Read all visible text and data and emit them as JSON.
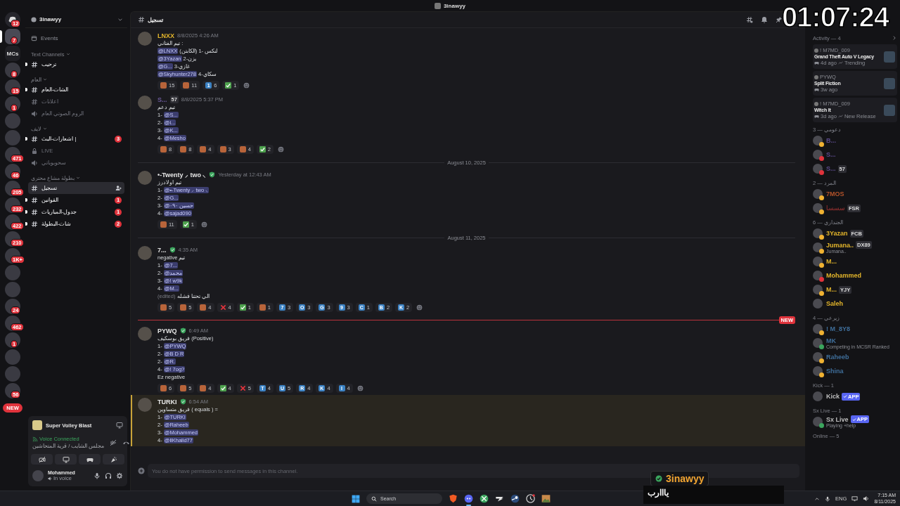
{
  "window": {
    "title": "3inawyy"
  },
  "server_rail": {
    "items": [
      {
        "kind": "home",
        "badge": "12",
        "selected": false
      },
      {
        "kind": "server",
        "badge": "7",
        "selected": true
      },
      {
        "kind": "text",
        "label": "MCs",
        "selected": false
      },
      {
        "kind": "server",
        "badge": "8",
        "selected": false
      },
      {
        "kind": "server",
        "badge": "15",
        "selected": false
      },
      {
        "kind": "server",
        "badge": "1",
        "selected": false
      },
      {
        "kind": "server",
        "selected": false
      },
      {
        "kind": "server",
        "selected": false
      },
      {
        "kind": "server",
        "badge": "471",
        "selected": false
      },
      {
        "kind": "server",
        "badge": "46",
        "selected": false
      },
      {
        "kind": "server",
        "badge": "205",
        "selected": false
      },
      {
        "kind": "server",
        "badge": "232",
        "selected": false
      },
      {
        "kind": "server",
        "badge": "422",
        "selected": false
      },
      {
        "kind": "server",
        "badge": "210",
        "selected": false
      },
      {
        "kind": "server",
        "badge": "1K+",
        "selected": false
      },
      {
        "kind": "server",
        "selected": false
      },
      {
        "kind": "server",
        "selected": false
      },
      {
        "kind": "server",
        "badge": "24",
        "selected": false
      },
      {
        "kind": "server",
        "badge": "462",
        "selected": false
      },
      {
        "kind": "server",
        "badge": "1",
        "selected": false
      },
      {
        "kind": "server",
        "selected": false
      },
      {
        "kind": "server",
        "selected": false
      },
      {
        "kind": "server",
        "badge": "56",
        "selected": false
      }
    ],
    "new_badge": "NEW"
  },
  "channel_sidebar": {
    "server_name": "3inawyy",
    "events": "Events",
    "categories": [
      {
        "name": "Text Channels",
        "channels": [
          {
            "name": "ترحيب",
            "kind": "text",
            "unread": true,
            "selected": false
          }
        ]
      },
      {
        "name": "العام",
        "channels": [
          {
            "name": "الشات-العام",
            "kind": "text",
            "unread": true,
            "selected": false
          },
          {
            "name": "اعلانات",
            "kind": "text",
            "unread": false,
            "selected": false
          },
          {
            "name": "الروم الصوتي العام",
            "kind": "voice",
            "unread": false,
            "selected": false
          }
        ]
      },
      {
        "name": "لايف",
        "channels": [
          {
            "name": "اشعارات-البث |",
            "kind": "text",
            "unread": true,
            "selected": false,
            "mentions": "3"
          },
          {
            "name": "LIVE",
            "kind": "locked",
            "unread": false,
            "selected": false
          },
          {
            "name": "سحوبوباتي",
            "kind": "voice",
            "unread": false,
            "selected": false
          }
        ]
      },
      {
        "name": "بطولة مشاع محتري",
        "channels": [
          {
            "name": "تسجيل",
            "kind": "text",
            "unread": false,
            "selected": true
          },
          {
            "name": "القوانين",
            "kind": "text",
            "unread": true,
            "selected": false,
            "mentions": "1"
          },
          {
            "name": "جدول-المباريات",
            "kind": "text",
            "unread": true,
            "selected": false,
            "mentions": "1"
          },
          {
            "name": "شات-البطولة",
            "kind": "text",
            "unread": true,
            "selected": false,
            "mentions": "2"
          }
        ]
      }
    ]
  },
  "voice_panel": {
    "activity": "Super Volley Blast",
    "status": "Voice Connected",
    "channel": "مجلس الشايب / قرية المتحاشين"
  },
  "user_panel": {
    "name": "Mohammed",
    "status": "In voice"
  },
  "chat": {
    "channel": "تسجيل",
    "input_placeholder": "You do not have permission to send messages in this channel.",
    "items": [
      {
        "kind": "message",
        "author": "LNXX",
        "color": "#e3b52b",
        "verified": false,
        "time": "8/8/2025 4:26 AM",
        "highlighted": false,
        "lines": [
          [
            {
              "kind": "text",
              "text": "تيم الفتاني :"
            }
          ],
          [
            {
              "kind": "mention",
              "text": "@LNXX"
            },
            {
              "kind": "text",
              "text": " (الكابتن) لنكس -1"
            }
          ],
          [
            {
              "kind": "mention",
              "text": "@3Yazan"
            },
            {
              "kind": "text",
              "text": " يزن-2"
            }
          ],
          [
            {
              "kind": "mention",
              "text": "@G..."
            },
            {
              "kind": "text",
              "text": " غازي-3"
            }
          ],
          [
            {
              "kind": "mention",
              "text": "@Skyhunter278"
            },
            {
              "kind": "text",
              "text": " سكاي-4"
            }
          ]
        ],
        "reactions": [
          {
            "kind": "emoji",
            "count": "15"
          },
          {
            "kind": "emoji",
            "count": "11"
          },
          {
            "kind": "key",
            "label": "1",
            "count": "6"
          },
          {
            "kind": "check",
            "count": "1"
          }
        ]
      },
      {
        "kind": "message",
        "author": "S...",
        "color": "#6c5a9a",
        "verified": false,
        "tag": "57",
        "time": "8/8/2025 5:37 PM",
        "highlighted": false,
        "lines": [
          [
            {
              "kind": "text",
              "text": "تيم دعم"
            }
          ],
          [
            {
              "kind": "text",
              "text": "1- "
            },
            {
              "kind": "mention",
              "text": "@S..."
            }
          ],
          [
            {
              "kind": "text",
              "text": "2- "
            },
            {
              "kind": "mention",
              "text": "@i..."
            }
          ],
          [
            {
              "kind": "text",
              "text": "3- "
            },
            {
              "kind": "mention",
              "text": "@K..."
            }
          ],
          [
            {
              "kind": "text",
              "text": "4- "
            },
            {
              "kind": "mention",
              "text": "@Mesho"
            }
          ]
        ],
        "reactions": [
          {
            "kind": "emoji",
            "count": "8"
          },
          {
            "kind": "emoji",
            "count": "8"
          },
          {
            "kind": "emoji",
            "count": "4"
          },
          {
            "kind": "emoji",
            "count": "3"
          },
          {
            "kind": "emoji",
            "count": "4"
          },
          {
            "kind": "check",
            "count": "2"
          }
        ]
      },
      {
        "kind": "date",
        "text": "August 10, 2025"
      },
      {
        "kind": "message",
        "author": "•-Twenty ⸝ two ⸜",
        "color": "#e6e6e6",
        "verified": true,
        "time": "Yesterday at 12:43 AM",
        "highlighted": false,
        "lines": [
          [
            {
              "kind": "text",
              "text": "تيم اولادرز"
            }
          ],
          [
            {
              "kind": "text",
              "text": "1- "
            },
            {
              "kind": "mention",
              "text": "@•-Twenty ⸝ two ⸜"
            }
          ],
          [
            {
              "kind": "text",
              "text": "2- "
            },
            {
              "kind": "mention",
              "text": "@G..."
            }
          ],
          [
            {
              "kind": "text",
              "text": "3- "
            },
            {
              "kind": "mention",
              "text": "@حسين ٠٩٠"
            }
          ],
          [
            {
              "kind": "text",
              "text": "4- "
            },
            {
              "kind": "mention",
              "text": "@sajad090"
            }
          ]
        ],
        "reactions": [
          {
            "kind": "emoji",
            "count": "11"
          },
          {
            "kind": "check",
            "count": "1"
          }
        ]
      },
      {
        "kind": "date",
        "text": "August 11, 2025"
      },
      {
        "kind": "message",
        "author": "7...",
        "color": "#e6e6e6",
        "verified": true,
        "time": "4:35 AM",
        "highlighted": false,
        "lines": [
          [
            {
              "kind": "text",
              "text": "negative تيم"
            }
          ],
          [
            {
              "kind": "text",
              "text": "1- "
            },
            {
              "kind": "mention",
              "text": "@7..."
            }
          ],
          [
            {
              "kind": "text",
              "text": "2- "
            },
            {
              "kind": "mention",
              "text": "@محمد"
            }
          ],
          [
            {
              "kind": "text",
              "text": "3- "
            },
            {
              "kind": "mention",
              "text": "@! w9k"
            }
          ],
          [
            {
              "kind": "text",
              "text": "4- "
            },
            {
              "kind": "mention",
              "text": "@M..."
            }
          ],
          [
            {
              "kind": "edited",
              "text": "(edited)"
            },
            {
              "kind": "text",
              "text": " الي تحتنا فشله"
            }
          ]
        ],
        "reactions": [
          {
            "kind": "emoji",
            "count": "5"
          },
          {
            "kind": "emoji",
            "count": "5"
          },
          {
            "kind": "emoji",
            "count": "4"
          },
          {
            "kind": "cross",
            "count": "4"
          },
          {
            "kind": "check",
            "count": "1"
          },
          {
            "kind": "emoji",
            "count": "1"
          },
          {
            "kind": "key",
            "label": "7",
            "count": "3"
          },
          {
            "kind": "key",
            "label": "O",
            "count": "3"
          },
          {
            "kind": "key",
            "label": "G",
            "count": "3"
          },
          {
            "kind": "key",
            "label": "9",
            "count": "3"
          },
          {
            "kind": "key",
            "label": "C",
            "count": "1"
          },
          {
            "kind": "key",
            "label": "B",
            "count": "2"
          },
          {
            "kind": "key",
            "label": "K",
            "count": "2"
          }
        ]
      },
      {
        "kind": "new",
        "text": "NEW"
      },
      {
        "kind": "message",
        "author": "PYWQ",
        "color": "#e6e6e6",
        "verified": true,
        "time": "6:49 AM",
        "highlighted": false,
        "lines": [
          [
            {
              "kind": "text",
              "text": "فريق بوسكيف (Positive)"
            }
          ],
          [
            {
              "kind": "text",
              "text": "1- "
            },
            {
              "kind": "mention",
              "text": "@PYWQ"
            }
          ],
          [
            {
              "kind": "text",
              "text": "2- "
            },
            {
              "kind": "mention",
              "text": "@B D R"
            }
          ],
          [
            {
              "kind": "text",
              "text": "2- "
            },
            {
              "kind": "mention",
              "text": "@R."
            }
          ],
          [
            {
              "kind": "text",
              "text": "4- "
            },
            {
              "kind": "mention",
              "text": "@! 7og?"
            }
          ],
          [
            {
              "kind": "text",
              "text": "Ez  negative"
            }
          ]
        ],
        "reactions": [
          {
            "kind": "emoji",
            "count": "6"
          },
          {
            "kind": "emoji",
            "count": "5"
          },
          {
            "kind": "emoji",
            "count": "4"
          },
          {
            "kind": "check",
            "count": "4"
          },
          {
            "kind": "cross",
            "count": "5"
          },
          {
            "kind": "key",
            "label": "T",
            "count": "4"
          },
          {
            "kind": "key",
            "label": "U",
            "count": "5"
          },
          {
            "kind": "key",
            "label": "R",
            "count": "4"
          },
          {
            "kind": "key",
            "label": "K",
            "count": "4"
          },
          {
            "kind": "key",
            "label": "I",
            "count": "4"
          }
        ]
      },
      {
        "kind": "message",
        "author": "TURKI",
        "color": "#e6e6e6",
        "verified": true,
        "time": "6:54 AM",
        "highlighted": true,
        "lines": [
          [
            {
              "kind": "text",
              "text": "فريق متساوين ( equals ) ="
            }
          ],
          [
            {
              "kind": "text",
              "text": "1- "
            },
            {
              "kind": "mention",
              "text": "@TURKI"
            }
          ],
          [
            {
              "kind": "text",
              "text": "2- "
            },
            {
              "kind": "mention",
              "text": "@Raheeb"
            }
          ],
          [
            {
              "kind": "text",
              "text": "3- "
            },
            {
              "kind": "mention",
              "text": "@Mohammed"
            }
          ],
          [
            {
              "kind": "text",
              "text": "4- "
            },
            {
              "kind": "mention",
              "text": "@llKhalid77"
            }
          ]
        ]
      }
    ]
  },
  "members": {
    "activity_title": "Activity — 4",
    "activities": [
      {
        "user": "! M7MD_009",
        "title": "Grand Theft Auto V Legacy",
        "time": "4d ago",
        "note": "Trending"
      },
      {
        "user": "PYWQ",
        "title": "Split Fiction",
        "time": "3w ago"
      },
      {
        "user": "! M7MD_009",
        "title": "Witch It",
        "time": "3d ago",
        "note": "New Release"
      }
    ],
    "groups": [
      {
        "title": "3 — دعومي",
        "members": [
          {
            "name": "B...",
            "color": "#5b4a8a",
            "presence": {
              "color": "#f0b232"
            }
          },
          {
            "name": "S...",
            "color": "#5b4a8a",
            "presence": {
              "color": "#e0333c"
            }
          },
          {
            "name": "S...",
            "color": "#5b4a8a",
            "presence": {
              "color": "#e0333c"
            },
            "tag": {
              "kind": "guild",
              "text": "57"
            }
          }
        ]
      },
      {
        "title": "2 — المرد",
        "members": [
          {
            "name": "7MOS",
            "color": "#b4532a",
            "presence": {
              "color": "#f0b232"
            }
          },
          {
            "name": "سسسا",
            "color": "#7a2a2a",
            "presence": {
              "color": "#f0b232"
            },
            "tag": {
              "kind": "guild",
              "text": "FSR"
            }
          }
        ]
      },
      {
        "title": "6 — الجنداري",
        "members": [
          {
            "name": "3Yazan",
            "color": "#e3b52b",
            "presence": {
              "color": "#f0b232"
            },
            "tag": {
              "kind": "guild",
              "text": "FCB"
            }
          },
          {
            "name": "Jumana..",
            "color": "#e3b52b",
            "presence": {
              "color": "#f0b232"
            },
            "tag": {
              "kind": "guild",
              "text": "DX89"
            },
            "subtext": "Jumana.."
          },
          {
            "name": "M...",
            "color": "#e3b52b",
            "presence": {
              "color": "#f0b232"
            }
          },
          {
            "name": "Mohammed",
            "color": "#e3b52b",
            "presence": {
              "color": "#e0333c"
            }
          },
          {
            "name": "M...",
            "color": "#e3b52b",
            "presence": {
              "color": "#f0b232"
            },
            "tag": {
              "kind": "guild",
              "text": "YJY"
            }
          },
          {
            "name": "Saleh",
            "color": "#e3b52b"
          }
        ]
      },
      {
        "title": "4 — زيرعي",
        "members": [
          {
            "name": "! M_8Y8",
            "color": "#3f6e9a",
            "presence": {
              "color": "#f0b232"
            }
          },
          {
            "name": "MK",
            "color": "#3f6e9a",
            "presence": {
              "color": "#3ba55d"
            },
            "subtext": "Competing in MCSR Ranked"
          },
          {
            "name": "Raheeb",
            "color": "#3f6e9a",
            "presence": {
              "color": "#f0b232"
            }
          },
          {
            "name": "Shina",
            "color": "#3f6e9a",
            "presence": {
              "color": "#f0b232"
            }
          }
        ]
      },
      {
        "title": "Kick — 1",
        "members": [
          {
            "name": "Kick",
            "color": "#bdbdbd",
            "tag": {
              "kind": "app",
              "text": "APP"
            }
          }
        ]
      },
      {
        "title": "Sx Live — 1",
        "members": [
          {
            "name": "Sx Live",
            "color": "#bdbdbd",
            "presence": {
              "color": "#3ba55d"
            },
            "tag": {
              "kind": "app",
              "text": "APP"
            },
            "subtext": "Playing +help"
          }
        ]
      },
      {
        "title": "Online — 5"
      }
    ]
  },
  "taskbar": {
    "search": "Search",
    "apps": [
      {
        "kind": "browser"
      },
      {
        "kind": "chat",
        "active": true
      },
      {
        "kind": "xbox"
      },
      {
        "kind": "epic"
      },
      {
        "kind": "steam"
      },
      {
        "kind": "clock"
      },
      {
        "kind": "photo"
      }
    ],
    "language": "ENG",
    "time": "7:15 AM",
    "date": "8/11/2025"
  },
  "stream_overlay": {
    "timer": "01:07:24",
    "name": "3inawyy",
    "caption": "يااارب"
  }
}
